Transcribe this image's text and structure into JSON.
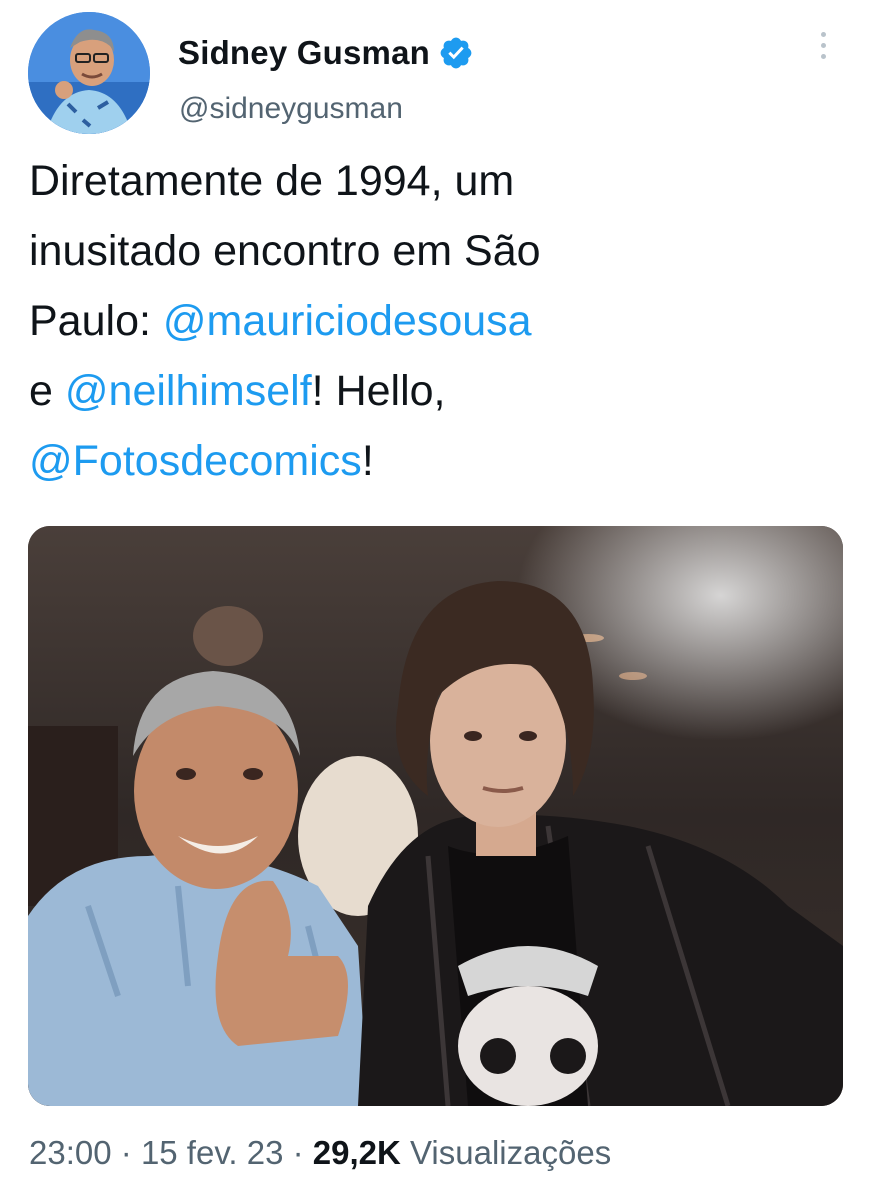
{
  "tweet": {
    "author": {
      "name": "Sidney Gusman",
      "handle": "@sidneygusman",
      "verified": true,
      "avatar": "profile-photo"
    },
    "text": {
      "line1": "Diretamente de 1994, um",
      "line2": "inusitado encontro em São",
      "line3_prefix": "Paulo: ",
      "mention1": "@mauriciodesousa",
      "line4_prefix": "e ",
      "mention2": "@neilhimself",
      "line4_suffix": "! Hello,",
      "mention3": "@Fotosdecomics",
      "line5_suffix": "!"
    },
    "media": {
      "description_icon": "photo"
    },
    "meta": {
      "time": "23:00",
      "separator": "·",
      "date": "15 fev. 23",
      "views_count": "29,2K",
      "views_label": "Visualizações"
    }
  },
  "colors": {
    "accent": "#1d9bf0",
    "secondary_text": "#536471",
    "primary_text": "#0f1419"
  },
  "icons": {
    "verified": "verified-badge-icon",
    "more": "more-vertical-icon"
  }
}
